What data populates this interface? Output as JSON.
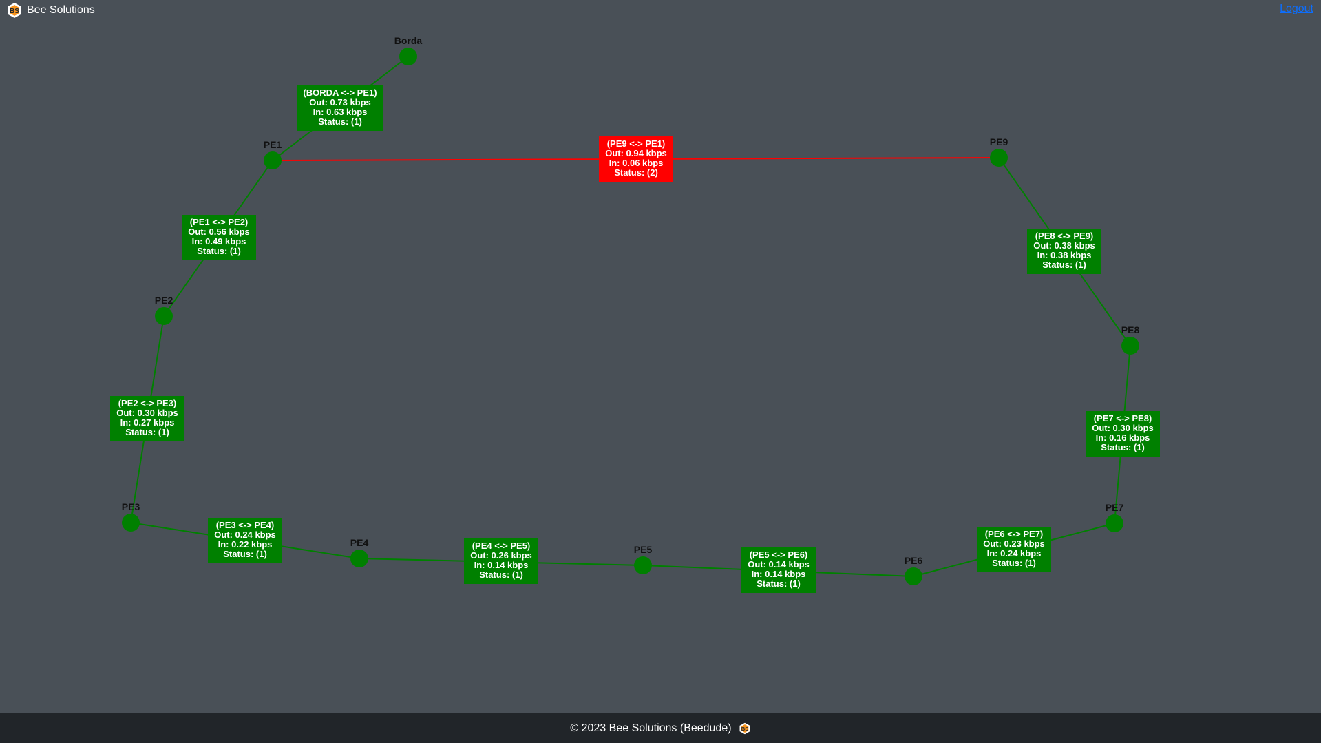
{
  "brand": {
    "name": "Bee Solutions",
    "logo_icon": "bee-hexagon-icon"
  },
  "nav": {
    "logout_label": "Logout"
  },
  "colors": {
    "background": "#495057",
    "node": "#008000",
    "link_ok": "#008000",
    "link_down": "#ff0000",
    "footer_bg": "#212529",
    "logout": "#0d6efd"
  },
  "topology": {
    "nodes": [
      {
        "id": "Borda",
        "label": "Borda"
      },
      {
        "id": "PE1",
        "label": "PE1"
      },
      {
        "id": "PE2",
        "label": "PE2"
      },
      {
        "id": "PE3",
        "label": "PE3"
      },
      {
        "id": "PE4",
        "label": "PE4"
      },
      {
        "id": "PE5",
        "label": "PE5"
      },
      {
        "id": "PE6",
        "label": "PE6"
      },
      {
        "id": "PE7",
        "label": "PE7"
      },
      {
        "id": "PE8",
        "label": "PE8"
      },
      {
        "id": "PE9",
        "label": "PE9"
      }
    ],
    "links": [
      {
        "id": "borda-pe1",
        "from": "Borda",
        "to": "PE1",
        "title": "(BORDA <-> PE1)",
        "out": "Out: 0.73 kbps",
        "in": "In: 0.63 kbps",
        "status": "Status: (1)",
        "status_code": 1
      },
      {
        "id": "pe1-pe2",
        "from": "PE1",
        "to": "PE2",
        "title": "(PE1 <-> PE2)",
        "out": "Out: 0.56 kbps",
        "in": "In: 0.49 kbps",
        "status": "Status: (1)",
        "status_code": 1
      },
      {
        "id": "pe2-pe3",
        "from": "PE2",
        "to": "PE3",
        "title": "(PE2 <-> PE3)",
        "out": "Out: 0.30 kbps",
        "in": "In: 0.27 kbps",
        "status": "Status: (1)",
        "status_code": 1
      },
      {
        "id": "pe3-pe4",
        "from": "PE3",
        "to": "PE4",
        "title": "(PE3 <-> PE4)",
        "out": "Out: 0.24 kbps",
        "in": "In: 0.22 kbps",
        "status": "Status: (1)",
        "status_code": 1
      },
      {
        "id": "pe4-pe5",
        "from": "PE4",
        "to": "PE5",
        "title": "(PE4 <-> PE5)",
        "out": "Out: 0.26 kbps",
        "in": "In: 0.14 kbps",
        "status": "Status: (1)",
        "status_code": 1
      },
      {
        "id": "pe5-pe6",
        "from": "PE5",
        "to": "PE6",
        "title": "(PE5 <-> PE6)",
        "out": "Out: 0.14 kbps",
        "in": "In: 0.14 kbps",
        "status": "Status: (1)",
        "status_code": 1
      },
      {
        "id": "pe6-pe7",
        "from": "PE6",
        "to": "PE7",
        "title": "(PE6 <-> PE7)",
        "out": "Out: 0.23 kbps",
        "in": "In: 0.24 kbps",
        "status": "Status: (1)",
        "status_code": 1
      },
      {
        "id": "pe7-pe8",
        "from": "PE7",
        "to": "PE8",
        "title": "(PE7 <-> PE8)",
        "out": "Out: 0.30 kbps",
        "in": "In: 0.16 kbps",
        "status": "Status: (1)",
        "status_code": 1
      },
      {
        "id": "pe8-pe9",
        "from": "PE8",
        "to": "PE9",
        "title": "(PE8 <-> PE9)",
        "out": "Out: 0.38 kbps",
        "in": "In: 0.38 kbps",
        "status": "Status: (1)",
        "status_code": 1
      },
      {
        "id": "pe9-pe1",
        "from": "PE9",
        "to": "PE1",
        "title": "(PE9 <-> PE1)",
        "out": "Out: 0.94 kbps",
        "in": "In: 0.06 kbps",
        "status": "Status: (2)",
        "status_code": 2
      }
    ]
  },
  "footer": {
    "text": "© 2023 Bee Solutions (Beedude)",
    "icon": "bee-hexagon-icon"
  }
}
